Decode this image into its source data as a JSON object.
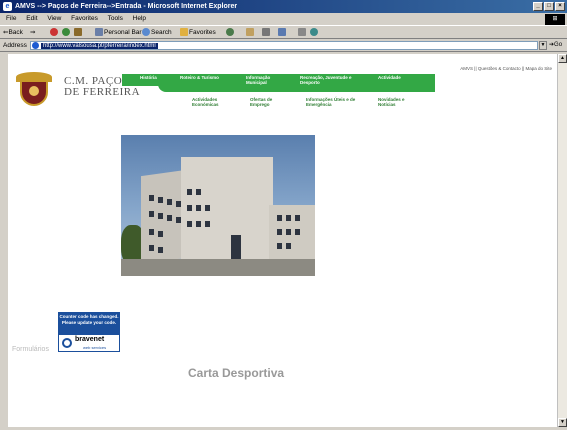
{
  "window": {
    "title": "AMVS --> Paços de Ferreira-->Entrada - Microsoft Internet Explorer",
    "buttons": [
      "_",
      "□",
      "×"
    ]
  },
  "menubar": {
    "items": [
      "File",
      "Edit",
      "View",
      "Favorites",
      "Tools",
      "Help"
    ]
  },
  "toolbar": {
    "back": "⇐Back",
    "forward": "⇒",
    "personal_bar": "Personal Bar",
    "search": "Search",
    "favorites": "Favorites"
  },
  "addressbar": {
    "label": "Address",
    "url": "http://www.valsousa.pt/pferreira/index.html",
    "go": "Go"
  },
  "page": {
    "toplinks": "AMVS || Questões & Contacto || Mapa do Site",
    "brand_line1": "C.M. PAÇOS",
    "brand_line2": "DE FERREIRA",
    "nav_primary": [
      "História",
      "Roteiro & Turismo",
      "Informação Municipal",
      "Recreação, Juventude e Desporto",
      "Actividade"
    ],
    "nav_secondary": [
      "Actividades Económicas",
      "Ofertas de Emprego",
      "Informações Úteis e de Emergência",
      "Novidades e Notícias"
    ],
    "counter": {
      "message": "Counter code has changed. Please update your code.",
      "brand": "bravenet",
      "sub": "web services"
    },
    "formularios": "Formulários",
    "carta": "Carta Desportiva"
  },
  "colors": {
    "nav_green": "#33a845",
    "title_blue": "#0a246a"
  }
}
